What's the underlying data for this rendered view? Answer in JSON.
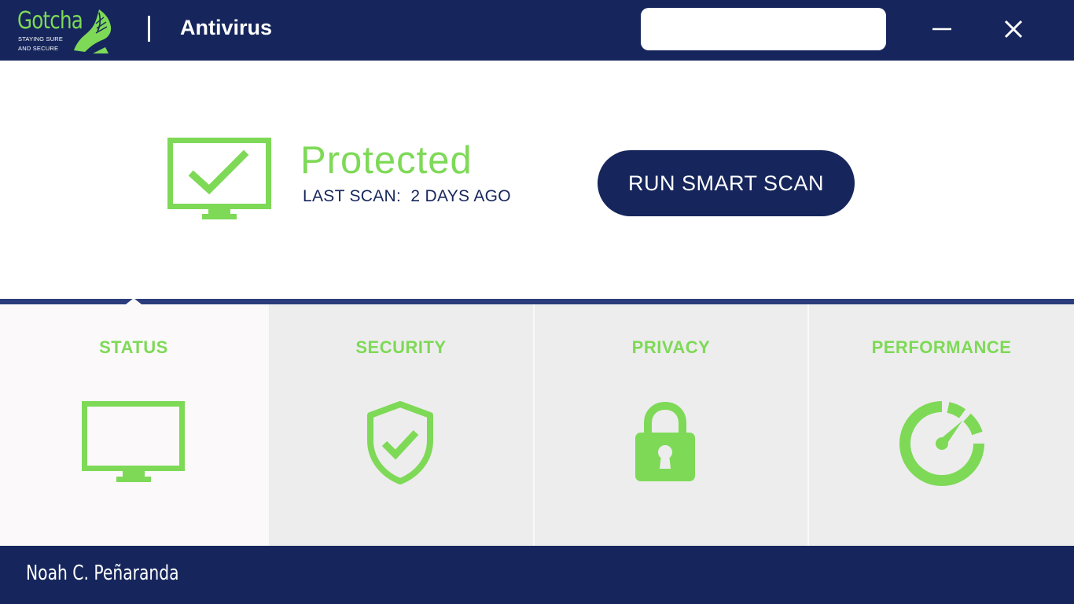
{
  "brand": {
    "name": "Gotcha",
    "tagline_line1": "STAYING SURE",
    "tagline_line2": "AND SECURE"
  },
  "window": {
    "title": "Antivirus",
    "search": {
      "value": "",
      "placeholder": ""
    },
    "minimize_icon": "minimize-icon",
    "close_icon": "close-icon"
  },
  "hero": {
    "icon": "monitor-check-icon",
    "status": "Protected",
    "last_scan": "LAST SCAN:  2 DAYS AGO",
    "scan_button": "RUN SMART SCAN"
  },
  "tabs": [
    {
      "label": "STATUS",
      "icon": "monitor-icon",
      "active": true
    },
    {
      "label": "SECURITY",
      "icon": "shield-check-icon",
      "active": false
    },
    {
      "label": "PRIVACY",
      "icon": "lock-icon",
      "active": false
    },
    {
      "label": "PERFORMANCE",
      "icon": "speedometer-icon",
      "active": false
    }
  ],
  "footer": {
    "author": "Noah C. Peñaranda"
  },
  "colors": {
    "navy": "#16265c",
    "accent_green": "#7ed957",
    "tab_background": "#ededed",
    "tab_active_background": "#fbf9f9"
  }
}
